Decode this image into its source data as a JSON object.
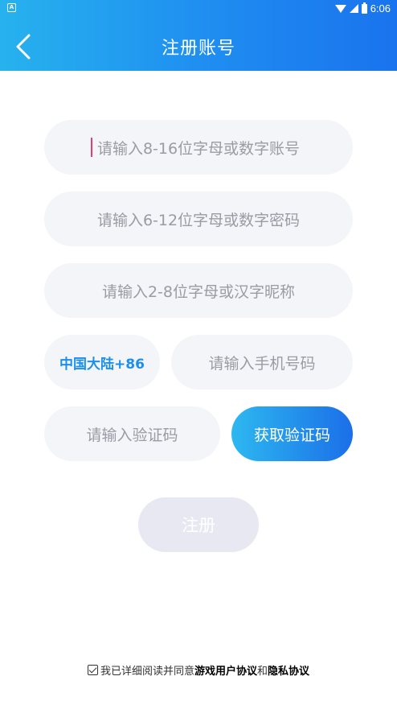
{
  "status_bar": {
    "time": "6:06",
    "notification_icon": "A"
  },
  "header": {
    "title": "注册账号",
    "back_icon": "chevron-left-icon"
  },
  "form": {
    "account_placeholder": "请输入8-16位字母或数字账号",
    "password_placeholder": "请输入6-12位字母或数字密码",
    "nickname_placeholder": "请输入2-8位字母或汉字昵称",
    "region_code": "中国大陆+86",
    "phone_placeholder": "请输入手机号码",
    "code_placeholder": "请输入验证码",
    "get_code_label": "获取验证码",
    "register_label": "注册"
  },
  "agreement": {
    "prefix": "我已详细阅读并同意",
    "user_agreement": "游戏用户协议",
    "conjunction": "和",
    "privacy_agreement": "隐私协议",
    "checked": true
  },
  "colors": {
    "header_start": "#27b2ee",
    "header_end": "#1a73ee",
    "field_bg": "#f4f5f9",
    "accent": "#1b8ff0",
    "register_disabled": "#e8e8f3"
  }
}
